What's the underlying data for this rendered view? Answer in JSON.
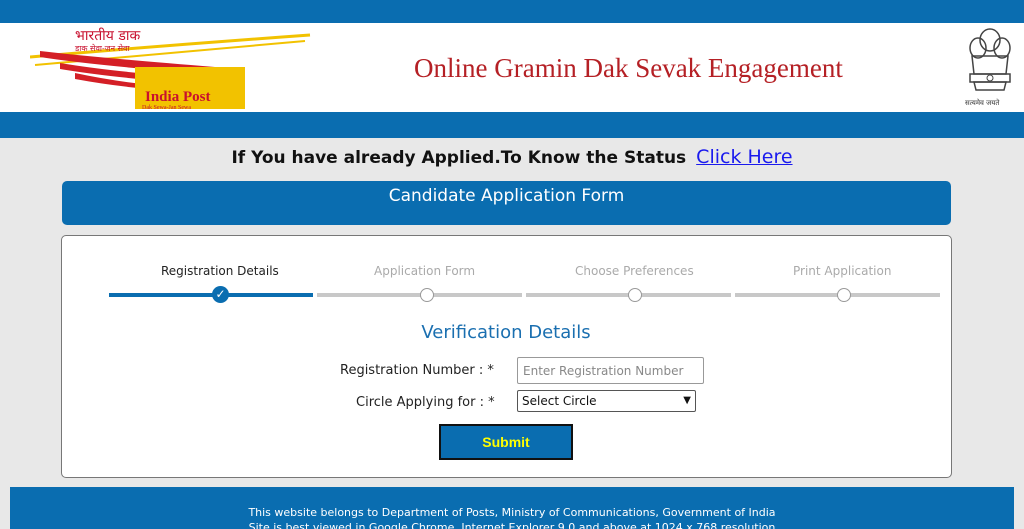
{
  "header": {
    "logo_hindi": "भारतीय डाक",
    "logo_hindi_sub": "डाक सेवा-जन सेवा",
    "logo_name": "India Post",
    "logo_tagline": "Dak Sewa-Jan Sewa",
    "site_title": "Online Gramin Dak Sevak Engagement",
    "emblem_motto": "सत्यमेव जयते"
  },
  "status": {
    "text": "If You have already Applied.To Know the Status",
    "link_label": "Click Here"
  },
  "form": {
    "banner_title": "Candidate Application Form",
    "steps": [
      {
        "label": "Registration Details",
        "state": "complete"
      },
      {
        "label": "Application Form",
        "state": "pending"
      },
      {
        "label": "Choose Preferences",
        "state": "pending"
      },
      {
        "label": "Print Application",
        "state": "pending"
      }
    ],
    "section_title": "Verification Details",
    "registration_label": "Registration Number : *",
    "registration_placeholder": "Enter Registration Number",
    "registration_value": "",
    "circle_label": "Circle Applying for : *",
    "circle_selected": "Select Circle",
    "submit_label": "Submit"
  },
  "footer": {
    "line1": "This website belongs to Department of Posts, Ministry of Communications, Government of India",
    "line2": "Site is best viewed in Google Chrome, Internet Explorer 9.0 and above at 1024 x 768 resolution"
  },
  "colors": {
    "brand_blue": "#0a6db0",
    "title_red": "#b52025",
    "submit_text": "#ffff00"
  }
}
